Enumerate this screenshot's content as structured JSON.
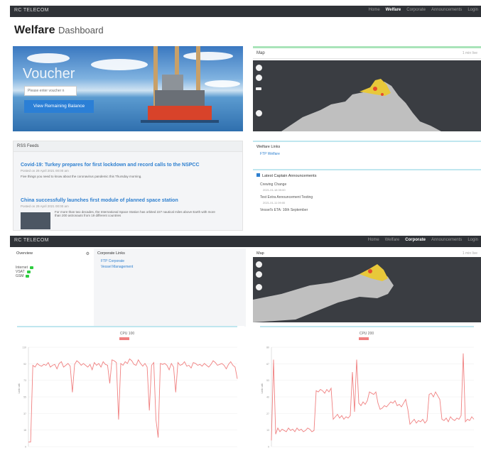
{
  "top": {
    "brand": "RC TELECOM",
    "nav": [
      "Home",
      "Welfare",
      "Corporate",
      "Announcements",
      "Login"
    ],
    "nav_active": "Welfare",
    "title_bold": "Welfare",
    "title_rest": "Dashboard",
    "voucher_title": "Voucher",
    "voucher_placeholder": "Please enter voucher n",
    "voucher_button": "View Remaining Balance",
    "map_title": "Map",
    "map_note": "1 min live",
    "rss_title": "RSS Feeds",
    "rss_items": [
      {
        "title": "Covid-19: Turkey prepares for first lockdown and record calls to the NSPCC",
        "meta": "Posted on 29 April 2021 00:00 am",
        "summary": "Five things you need to know about the coronavirus pandemic this Thursday morning."
      },
      {
        "title": "China successfully launches first module of planned space station",
        "meta": "Posted on 29 April 2021 00:00 am",
        "summary": "For more than two decades, the International Space Station has orbited 227 nautical miles above Earth with more than 200 astronauts from 19 different countries"
      }
    ],
    "welfare_links_title": "Welfare Links",
    "welfare_links": [
      "FTP Welfare"
    ],
    "ann_title": "Latest Captain Announcements",
    "announcements": [
      {
        "title": "Crewing Change",
        "date": "2021-01-18 09:00"
      },
      {
        "title": "Test Extra Announcement Testing",
        "date": "2021-01-11 09:00"
      },
      {
        "title": "Vessel's ETA: 16th September",
        "date": ""
      }
    ]
  },
  "bottom": {
    "brand": "RC TELECOM",
    "nav": [
      "Home",
      "Welfare",
      "Corporate",
      "Announcements",
      "Login"
    ],
    "nav_active": "Corporate",
    "overview_title": "Overview",
    "overview_items": [
      "Internet",
      "VSAT",
      "GSM"
    ],
    "corp_title": "Corporate Links",
    "corp_links": [
      "FTP Corporate",
      "Vessel Management"
    ],
    "map_title": "Map",
    "map_note": "1 min live",
    "chart_left_title": "CPU 100",
    "chart_right_title": "CPU 200",
    "y_label": "Link util."
  },
  "colors": {
    "topbar": "#2f3237",
    "link": "#2f80d0",
    "accent": "#bfe6ef",
    "primary_btn": "#2b7fd6",
    "series": "#f08080"
  },
  "chart_data": [
    {
      "type": "line",
      "title": "CPU 100",
      "ylabel": "Link util.",
      "ylim": [
        0,
        110
      ],
      "series": [
        {
          "name": "",
          "values": [
            5,
            5,
            90,
            88,
            92,
            90,
            89,
            91,
            90,
            93,
            88,
            90,
            91,
            86,
            92,
            94,
            88,
            90,
            92,
            89,
            60,
            91,
            95,
            93,
            90,
            92,
            90,
            88,
            91,
            85,
            93,
            90,
            92,
            88,
            94,
            91,
            90,
            70,
            96,
            95,
            93,
            30,
            92,
            90,
            94,
            92,
            97,
            95,
            91,
            90,
            96,
            92,
            89,
            92,
            88,
            40,
            90,
            93,
            30,
            10,
            92,
            91,
            92,
            90,
            85,
            92,
            88,
            60,
            93,
            90,
            91,
            94,
            89,
            90,
            87,
            93,
            92,
            90,
            91,
            89,
            92,
            90,
            88,
            91,
            95,
            93,
            90,
            91,
            92,
            90,
            86,
            91,
            94,
            90,
            88,
            75
          ]
        }
      ]
    },
    {
      "type": "line",
      "title": "CPU 200",
      "ylabel": "Link util.",
      "ylim": [
        0,
        80
      ],
      "series": [
        {
          "name": "",
          "values": [
            5,
            70,
            10,
            15,
            12,
            14,
            13,
            12,
            15,
            13,
            14,
            12,
            15,
            13,
            14,
            12,
            13,
            15,
            14,
            12,
            13,
            45,
            44,
            46,
            45,
            43,
            46,
            44,
            47,
            22,
            24,
            26,
            23,
            25,
            22,
            24,
            23,
            25,
            60,
            28,
            70,
            35,
            33,
            36,
            34,
            37,
            44,
            43,
            42,
            44,
            35,
            30,
            31,
            33,
            32,
            34,
            36,
            35,
            37,
            33,
            34,
            32,
            35,
            38,
            30,
            18,
            20,
            22,
            19,
            21,
            20,
            22,
            19,
            21,
            42,
            43,
            40,
            44,
            41,
            38,
            22,
            21,
            23,
            20,
            24,
            22,
            21,
            23,
            22,
            25,
            75,
            20,
            22,
            21,
            24,
            22
          ]
        }
      ]
    }
  ]
}
